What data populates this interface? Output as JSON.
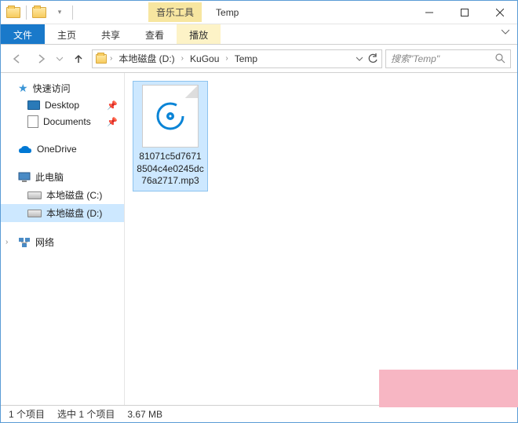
{
  "window": {
    "contextual_tab": "音乐工具",
    "title": "Temp"
  },
  "ribbon": {
    "file": "文件",
    "home": "主页",
    "share": "共享",
    "view": "查看",
    "play": "播放"
  },
  "breadcrumb": {
    "items": [
      "本地磁盘 (D:)",
      "KuGou",
      "Temp"
    ]
  },
  "search": {
    "placeholder": "搜索\"Temp\""
  },
  "sidebar": {
    "quick_access": "快速访问",
    "desktop": "Desktop",
    "documents": "Documents",
    "onedrive": "OneDrive",
    "this_pc": "此电脑",
    "drive_c": "本地磁盘 (C:)",
    "drive_d": "本地磁盘 (D:)",
    "network": "网络"
  },
  "files": [
    {
      "name": "81071c5d76718504c4e0245dc76a2717.mp3"
    }
  ],
  "status": {
    "items": "1 个项目",
    "selected": "选中 1 个项目",
    "size": "3.67 MB"
  }
}
